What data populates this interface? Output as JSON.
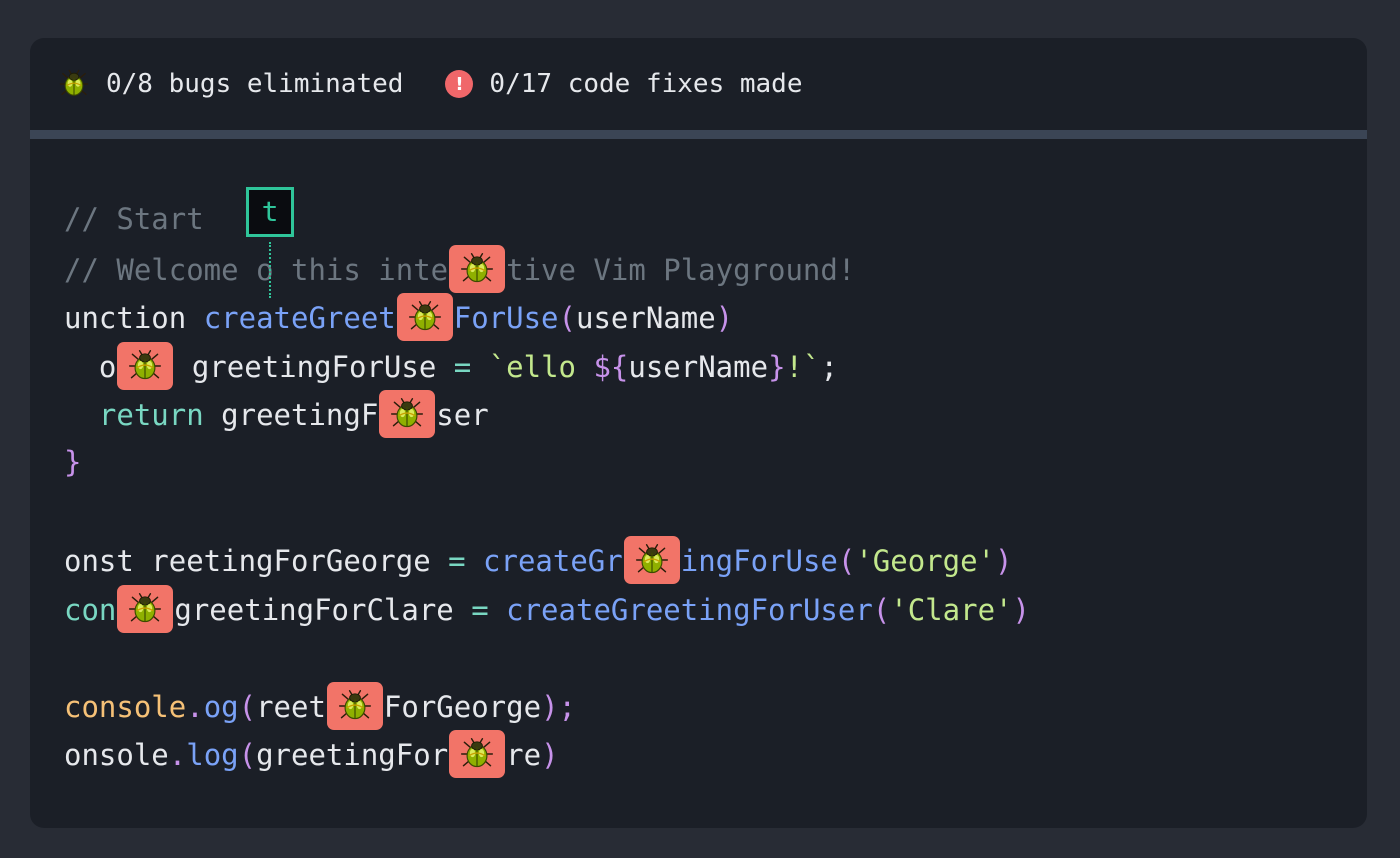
{
  "status": {
    "bugs_icon": "beetle-icon",
    "bugs_text": "0/8 bugs eliminated",
    "fixes_icon": "exclamation-icon",
    "fixes_glyph": "!",
    "fixes_text": "0/17 code fixes made"
  },
  "cursor": {
    "char": "t"
  },
  "colors": {
    "background": "#282c35",
    "panel": "#1b1f27",
    "bug_marker": "#f27468",
    "cursor": "#2fc59a",
    "keyword": "#79d7c2",
    "function": "#7aa2f7",
    "string": "#c3e88d",
    "punctuation": "#c792ea",
    "comment": "#6c7680"
  },
  "code": {
    "l1": [
      "// Start"
    ],
    "l2": [
      "// Welcome ",
      "o this inte",
      "tive Vim Playground!"
    ],
    "l3": [
      "unction ",
      "createGreet",
      "ForUse",
      "(",
      "userName",
      ")"
    ],
    "l4": [
      "  o",
      " greetingForUse ",
      "=",
      " ",
      "`ello ",
      "${",
      "userName",
      "}",
      "!`",
      ";"
    ],
    "l5": [
      "  return",
      " greetingF",
      "ser"
    ],
    "l6": [
      "}"
    ],
    "l7": [
      "onst reetingForGeorge ",
      "=",
      " ",
      "createGr",
      "ingForUse",
      "(",
      "'George'",
      ")"
    ],
    "l8": [
      "con",
      "greetingForClare ",
      "=",
      " ",
      "createGreetingForUser",
      "(",
      "'Clare'",
      ")"
    ],
    "l9": [
      "console",
      ".",
      "og",
      "(",
      "reet",
      "ForGeorge",
      ");"
    ],
    "l10": [
      "onsole",
      ".",
      "log",
      "(",
      "greetingFor",
      "re",
      ")"
    ]
  }
}
